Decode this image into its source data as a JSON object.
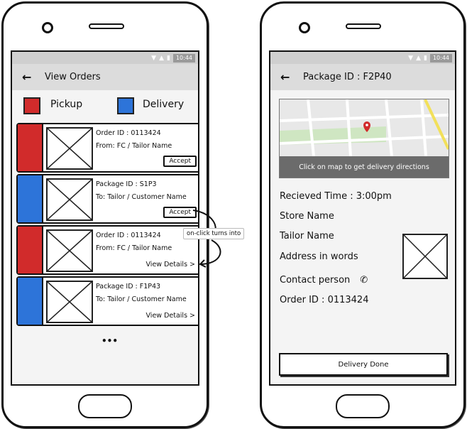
{
  "left_screen": {
    "status_time": "10:44",
    "title": "View Orders",
    "legend": [
      {
        "label": "Pickup",
        "color": "#d12b2b"
      },
      {
        "label": "Delivery",
        "color": "#2d74d9"
      }
    ],
    "cards": [
      {
        "type": "pickup",
        "color": "#d12b2b",
        "line1": "Order ID : 0113424",
        "line2": "From: FC / Tailor Name",
        "action": "Accept"
      },
      {
        "type": "delivery",
        "color": "#2d74d9",
        "line1": "Package ID : S1P3",
        "line2": "To: Tailor / Customer Name",
        "action": "Accept"
      },
      {
        "type": "pickup",
        "color": "#d12b2b",
        "line1": "Order ID : 0113424",
        "line2": "From: FC / Tailor Name",
        "action": "View Details >"
      },
      {
        "type": "delivery",
        "color": "#2d74d9",
        "line1": "Package ID : F1P43",
        "line2": "To: Tailor / Customer Name",
        "action": "View Details >"
      }
    ],
    "more": "•••",
    "annotation": "on-click turns into"
  },
  "right_screen": {
    "status_time": "10:44",
    "title": "Package ID : F2P40",
    "map_caption": "Click on map to get delivery directions",
    "received_time": "Recieved Time : 3:00pm",
    "store_name": "Store Name",
    "tailor_name": "Tailor Name",
    "address": "Address in words",
    "contact": "Contact person",
    "order_id": "Order ID : 0113424",
    "done_button": "Delivery Done"
  },
  "icons": {
    "back": "arrow-left-icon",
    "phone": "phone-icon",
    "map_pin": "map-pin-icon",
    "wifi": "wifi-icon",
    "signal": "signal-icon",
    "battery": "battery-icon"
  }
}
